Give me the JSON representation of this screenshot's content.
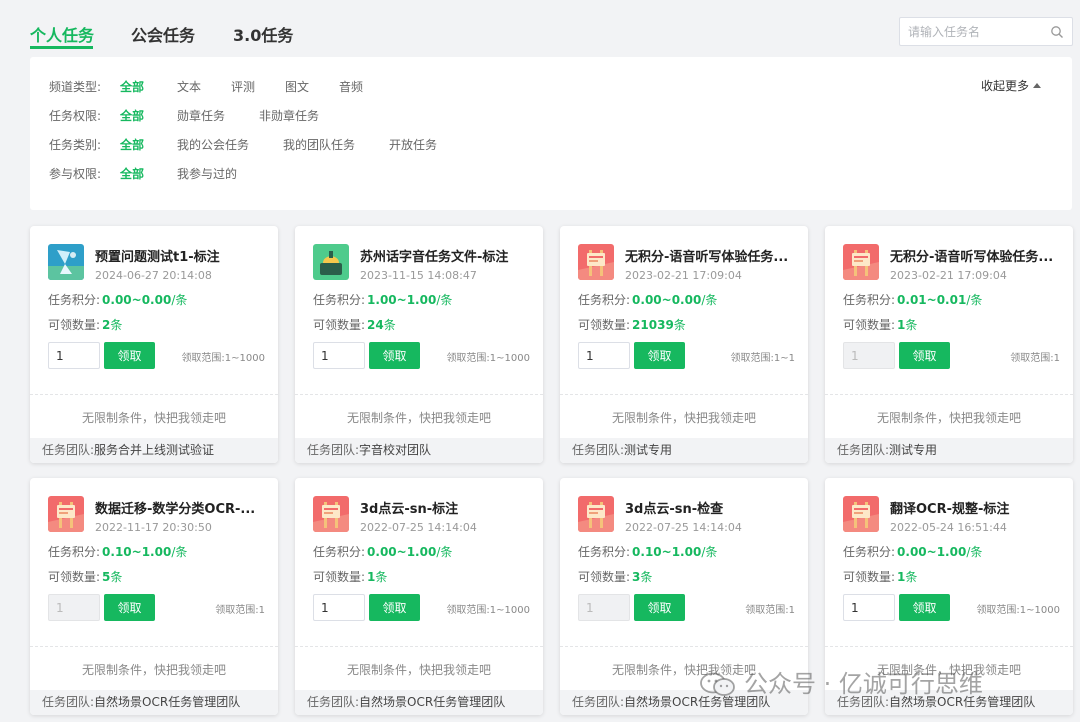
{
  "tabs": [
    {
      "label": "个人任务",
      "active": true
    },
    {
      "label": "公会任务",
      "active": false
    },
    {
      "label": "3.0任务",
      "active": false
    }
  ],
  "search": {
    "placeholder": "请输入任务名",
    "icon": "search-icon"
  },
  "filters": {
    "collapse_label": "收起更多",
    "rows": [
      {
        "label": "频道类型:",
        "options": [
          "全部",
          "文本",
          "评测",
          "图文",
          "音频"
        ],
        "selected": "全部"
      },
      {
        "label": "任务权限:",
        "options": [
          "全部",
          "勋章任务",
          "非勋章任务"
        ],
        "selected": "全部"
      },
      {
        "label": "任务类别:",
        "options": [
          "全部",
          "我的公会任务",
          "我的团队任务",
          "开放任务"
        ],
        "selected": "全部"
      },
      {
        "label": "参与权限:",
        "options": [
          "全部",
          "我参与过的"
        ],
        "selected": "全部"
      }
    ]
  },
  "card_labels": {
    "points": "任务积分:",
    "quantity": "可领数量:",
    "claim_button": "领取",
    "team": "任务团队:",
    "unit_points": "/条",
    "unit_count": "条"
  },
  "cards": [
    {
      "title": "预置问题测试t1-标注",
      "date": "2024-06-27 20:14:08",
      "thumb": "blue",
      "points": "0.00~0.00",
      "count": "2",
      "qty": "1",
      "qty_disabled": false,
      "range": "领取范围:1~1000",
      "condition": "无限制条件，快把我领走吧",
      "team": "服务合并上线测试验证"
    },
    {
      "title": "苏州话字音任务文件-标注",
      "date": "2023-11-15 14:08:47",
      "thumb": "green",
      "points": "1.00~1.00",
      "count": "24",
      "qty": "1",
      "qty_disabled": false,
      "range": "领取范围:1~1000",
      "condition": "无限制条件，快把我领走吧",
      "team": "字音校对团队"
    },
    {
      "title": "无积分-语音听写体验任务...",
      "date": "2023-02-21 17:09:04",
      "thumb": "pink",
      "points": "0.00~0.00",
      "count": "21039",
      "qty": "1",
      "qty_disabled": false,
      "range": "领取范围:1~1",
      "condition": "无限制条件，快把我领走吧",
      "team": "测试专用"
    },
    {
      "title": "无积分-语音听写体验任务...",
      "date": "2023-02-21 17:09:04",
      "thumb": "pink",
      "points": "0.01~0.01",
      "count": "1",
      "qty": "1",
      "qty_disabled": true,
      "range": "领取范围:1",
      "condition": "无限制条件，快把我领走吧",
      "team": "测试专用"
    },
    {
      "title": "数据迁移-数学分类OCR-...",
      "date": "2022-11-17 20:30:50",
      "thumb": "pink",
      "points": "0.10~1.00",
      "count": "5",
      "qty": "1",
      "qty_disabled": true,
      "range": "领取范围:1",
      "condition": "无限制条件，快把我领走吧",
      "team": "自然场景OCR任务管理团队"
    },
    {
      "title": "3d点云-sn-标注",
      "date": "2022-07-25 14:14:04",
      "thumb": "pink",
      "points": "0.00~1.00",
      "count": "1",
      "qty": "1",
      "qty_disabled": false,
      "range": "领取范围:1~1000",
      "condition": "无限制条件，快把我领走吧",
      "team": "自然场景OCR任务管理团队"
    },
    {
      "title": "3d点云-sn-检查",
      "date": "2022-07-25 14:14:04",
      "thumb": "pink",
      "points": "0.10~1.00",
      "count": "3",
      "qty": "1",
      "qty_disabled": true,
      "range": "领取范围:1",
      "condition": "无限制条件，快把我领走吧",
      "team": "自然场景OCR任务管理团队"
    },
    {
      "title": "翻译OCR-规整-标注",
      "date": "2022-05-24 16:51:44",
      "thumb": "pink",
      "points": "0.00~1.00",
      "count": "1",
      "qty": "1",
      "qty_disabled": false,
      "range": "领取范围:1~1000",
      "condition": "无限制条件，快把我领走吧",
      "team": "自然场景OCR任务管理团队"
    }
  ],
  "watermark": {
    "text": "公众号 · 亿诚可行思维",
    "icon": "wechat-icon"
  },
  "colors": {
    "accent": "#16b85f",
    "background": "#f2f3f5"
  }
}
